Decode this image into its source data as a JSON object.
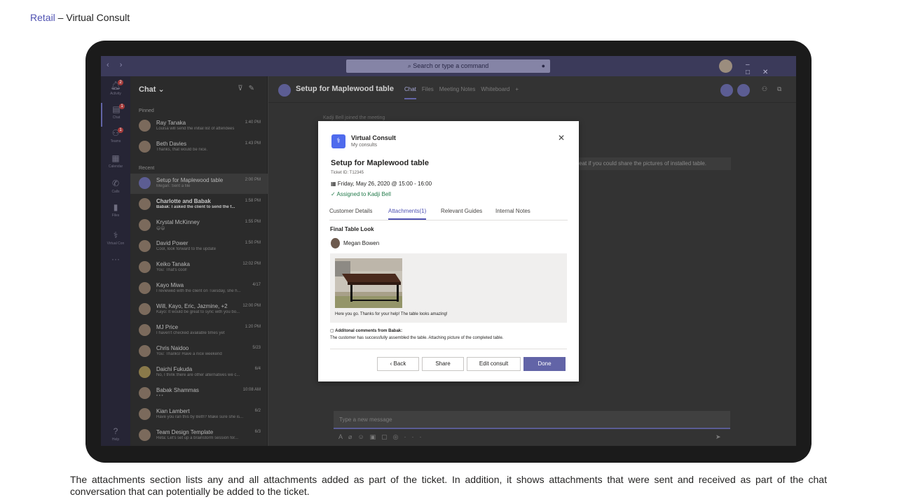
{
  "slide": {
    "title_accent": "Retail",
    "title_rest": " – Virtual Consult",
    "caption": "The attachments section lists any and all attachments added as part of the ticket. In addition, it shows attachments that were sent and received as part of the chat conversation that can potentially be added to the ticket."
  },
  "titlebar": {
    "search_placeholder": "Search or type a command"
  },
  "rail": {
    "items": [
      {
        "label": "Activity",
        "icon": "bell-icon",
        "badge": "2"
      },
      {
        "label": "Chat",
        "icon": "chat-icon",
        "badge": "1"
      },
      {
        "label": "Teams",
        "icon": "teams-icon",
        "badge": "1"
      },
      {
        "label": "Calendar",
        "icon": "calendar-icon"
      },
      {
        "label": "Calls",
        "icon": "phone-icon"
      },
      {
        "label": "Files",
        "icon": "file-icon"
      },
      {
        "label": "Virtual Con",
        "icon": "virtual-consult-icon"
      },
      {
        "label": "Help",
        "icon": "help-icon"
      }
    ]
  },
  "chatlist": {
    "header": "Chat",
    "pinned_label": "Pinned",
    "recent_label": "Recent",
    "pinned": [
      {
        "name": "Ray Tanaka",
        "preview": "Louisa will send the initial list of attendees",
        "time": "1:40 PM"
      },
      {
        "name": "Beth Davies",
        "preview": "Thanks, that would be nice.",
        "time": "1:43 PM"
      }
    ],
    "recent": [
      {
        "name": "Setup for Maplewood table",
        "preview": "Megan: Sent a file",
        "time": "2:00 PM"
      },
      {
        "name": "Charlotte and Babak",
        "preview": "Babak: I asked the client to send the f...",
        "time": "1:58 PM"
      },
      {
        "name": "Krystal McKinney",
        "preview": "😄😄",
        "time": "1:55 PM"
      },
      {
        "name": "David Power",
        "preview": "Cool, look forward to the update",
        "time": "1:50 PM"
      },
      {
        "name": "Keiko Tanaka",
        "preview": "You: That's cool!",
        "time": "12:02 PM"
      },
      {
        "name": "Kayo Miwa",
        "preview": "I reviewed with the client on Tuesday, she h...",
        "time": "4/17"
      },
      {
        "name": "Will, Kayo, Eric, Jazmine, +2",
        "preview": "Kayo: It would be great to sync with you bo...",
        "time": "12:00 PM"
      },
      {
        "name": "MJ Price",
        "preview": "I haven't checked available times yet",
        "time": "1:20 PM"
      },
      {
        "name": "Chris Naidoo",
        "preview": "You: Thanks! Have a nice weekend",
        "time": "5/23"
      },
      {
        "name": "Daichi Fukuda",
        "preview": "No, I think there are other alternatives we c...",
        "time": "6/4"
      },
      {
        "name": "Babak Shammas",
        "preview": "• • •",
        "time": "10:08 AM"
      },
      {
        "name": "Kian Lambert",
        "preview": "Have you ran this by Beth? Make sure she is...",
        "time": "6/2"
      },
      {
        "name": "Team Design Template",
        "preview": "Reta: Let's set up a brainstorm session for...",
        "time": "6/3"
      }
    ]
  },
  "main": {
    "title": "Setup for Maplewood table",
    "tabs": [
      "Chat",
      "Files",
      "Meeting Notes",
      "Whiteboard"
    ],
    "system_message": "Kadji Bell joined the meeting",
    "message_partial": "great if you could share the pictures of installed table.",
    "composer_placeholder": "Type a new message"
  },
  "dialog": {
    "app_name": "Virtual Consult",
    "app_sub": "My consults",
    "title": "Setup for Maplewood table",
    "ticket_id": "Ticket ID: T12345",
    "date": "Friday, May 26, 2020 @ 15:00 - 16:00",
    "assigned": "Assigned to Kadji Bell",
    "tabs": [
      "Customer Details",
      "Attachments(1)",
      "Relevant Guides",
      "Internal Notes"
    ],
    "section_title": "Final Table Look",
    "sender": "Megan Bowen",
    "photo_caption": "Here you go. Thanks for your help! The table looks amazing!",
    "comments_header": "Additonal comments from Babak:",
    "comments_text": "The customer has successfully assembled the table. Attaching picture of the completed table.",
    "buttons": {
      "back": "Back",
      "share": "Share",
      "edit": "Edit consult",
      "done": "Done"
    }
  }
}
